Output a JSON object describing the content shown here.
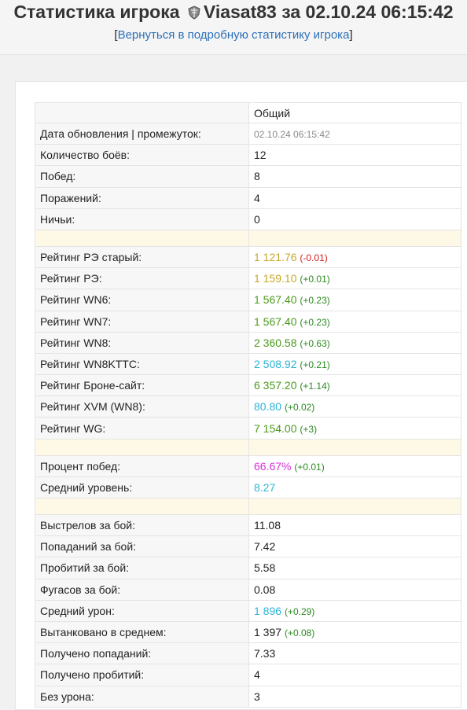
{
  "header": {
    "title_prefix": "Статистика игрока",
    "player": "Viasat83",
    "title_suffix": "за 02.10.24 06:15:42",
    "back_open": "[",
    "back_link": "Вернуться в подробную статистику игрока",
    "back_close": "]"
  },
  "colors": {
    "yellow": "#c8a828",
    "green": "#4a9a1a",
    "lightgreen": "#4ba22a",
    "cyan": "#2bb5d8",
    "magenta": "#d632d6",
    "plus": "#2a8a20",
    "minus": "#d21e1e"
  },
  "table": {
    "column_header": "Общий",
    "rows": [
      {
        "label": "Дата обновления | промежуток:",
        "value": "02.10.24 06:15:42",
        "style": "small-gray"
      },
      {
        "label": "Количество боёв:",
        "value": "12"
      },
      {
        "label": "Побед:",
        "value": "8"
      },
      {
        "label": "Поражений:",
        "value": "4"
      },
      {
        "label": "Ничьи:",
        "value": "0"
      },
      {
        "sep": true
      },
      {
        "label": "Рейтинг РЭ старый:",
        "value": "1 121.76",
        "color": "yellow",
        "delta": "(-0.01)",
        "delta_sign": "minus"
      },
      {
        "label": "Рейтинг РЭ:",
        "value": "1 159.10",
        "color": "yellow",
        "delta": "(+0.01)",
        "delta_sign": "plus"
      },
      {
        "label": "Рейтинг WN6:",
        "value": "1 567.40",
        "color": "green",
        "delta": "(+0.23)",
        "delta_sign": "plus"
      },
      {
        "label": "Рейтинг WN7:",
        "value": "1 567.40",
        "color": "green",
        "delta": "(+0.23)",
        "delta_sign": "plus"
      },
      {
        "label": "Рейтинг WN8:",
        "value": "2 360.58",
        "color": "green",
        "delta": "(+0.63)",
        "delta_sign": "plus"
      },
      {
        "label": "Рейтинг WN8KTTC:",
        "value": "2 508.92",
        "color": "cyan",
        "delta": "(+0.21)",
        "delta_sign": "plus"
      },
      {
        "label": "Рейтинг Броне-сайт:",
        "value": "6 357.20",
        "color": "green",
        "delta": "(+1.14)",
        "delta_sign": "plus"
      },
      {
        "label": "Рейтинг XVM (WN8):",
        "value": "80.80",
        "color": "cyan",
        "delta": "(+0.02)",
        "delta_sign": "plus"
      },
      {
        "label": "Рейтинг WG:",
        "value": "7 154.00",
        "color": "green",
        "delta": "(+3)",
        "delta_sign": "plus"
      },
      {
        "sep": true
      },
      {
        "label": "Процент побед:",
        "value": "66.67%",
        "color": "magenta",
        "delta": "(+0.01)",
        "delta_sign": "plus"
      },
      {
        "label": "Средний уровень:",
        "value": "8.27",
        "color": "cyan"
      },
      {
        "sep": true
      },
      {
        "label": "Выстрелов за бой:",
        "value": "11.08"
      },
      {
        "label": "Попаданий за бой:",
        "value": "7.42"
      },
      {
        "label": "Пробитий за бой:",
        "value": "5.58"
      },
      {
        "label": "Фугасов за бой:",
        "value": "0.08"
      },
      {
        "label": "Средний урон:",
        "value": "1 896",
        "color": "cyan",
        "delta": "(+0.29)",
        "delta_sign": "plus"
      },
      {
        "label": "Вытанковано в среднем:",
        "value": "1 397",
        "delta": "(+0.08)",
        "delta_sign": "plus"
      },
      {
        "label": "Получено попаданий:",
        "value": "7.33"
      },
      {
        "label": "Получено пробитий:",
        "value": "4"
      },
      {
        "label": "Без урона:",
        "value": "3"
      }
    ]
  }
}
